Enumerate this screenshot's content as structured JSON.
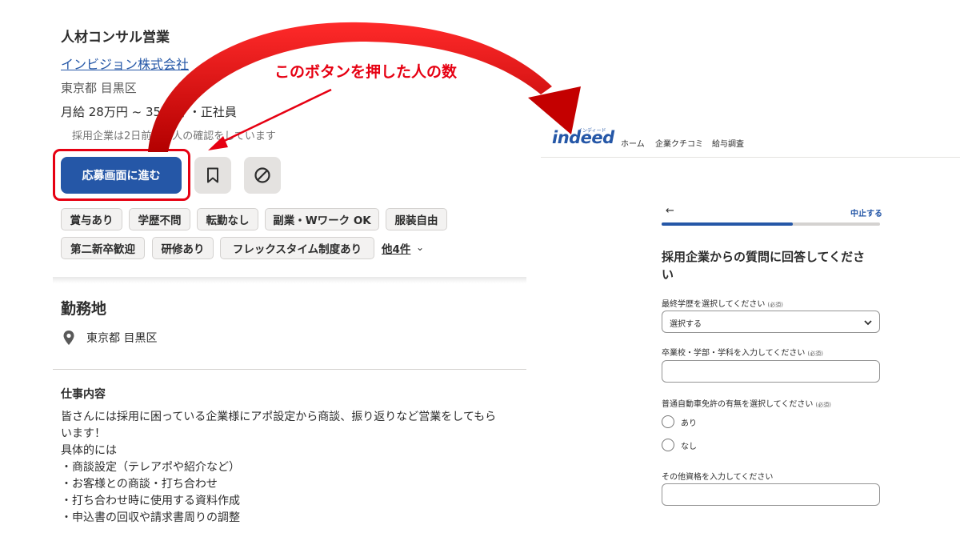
{
  "job": {
    "title": "人材コンサル営業",
    "company": "インビジョン株式会社",
    "location": "東京都 目黒区",
    "salary": "月給 28万円 ~ 35万円 ・正社員",
    "confirm_note": "採用企業は2日前に求人の確認をしています",
    "apply_label": "応募画面に進む",
    "bookmark_icon": "bookmark-icon",
    "not_interested_icon": "not-interested-icon",
    "tags_row1": [
      "賞与あり",
      "学歴不問",
      "転勤なし",
      "副業・Wワーク OK",
      "服装自由"
    ],
    "tags_row2": [
      "第二新卒歓迎",
      "研修あり",
      "フレックスタイム制度あり"
    ],
    "more_tags_label": "他4件"
  },
  "workplace": {
    "heading": "勤務地",
    "location": "東京都 目黒区",
    "pin_icon": "location-pin-icon"
  },
  "duties": {
    "heading": "仕事内容",
    "lines": [
      "皆さんには採用に困っている企業様にアポ設定から商談、振り返りなど営業をしてもら",
      "います！",
      "具体的には",
      "・商談設定（テレアポや紹介など）",
      "・お客様との商談・打ち合わせ",
      "・打ち合わせ時に使用する資料作成",
      "・申込書の回収や請求書周りの調整"
    ]
  },
  "annotation": {
    "text": "このボタンを押した人の数",
    "color": "#e60012"
  },
  "indeed": {
    "logo": "indeed",
    "logo_sub": "インディード",
    "nav": [
      "ホーム",
      "企業クチコミ",
      "給与調査"
    ],
    "back_icon": "←",
    "quit_label": "中止する",
    "progress": 0.6,
    "form_title_line1": "採用企業からの質問に回答してくださ",
    "form_title_line2": "い",
    "q1_label": "最終学歴を選択してください",
    "q1_req": "(必須)",
    "q1_value": "選択する",
    "q2_label": "卒業校・学部・学科を入力してください",
    "q2_req": "(必須)",
    "q2_value": "",
    "q3_label": "普通自動車免許の有無を選択してください",
    "q3_req": "(必須)",
    "q3_options": [
      "あり",
      "なし"
    ],
    "q4_label": "その他資格を入力してください",
    "q4_value": ""
  },
  "colors": {
    "brand_blue": "#2557a7",
    "annotation_red": "#e60012"
  }
}
